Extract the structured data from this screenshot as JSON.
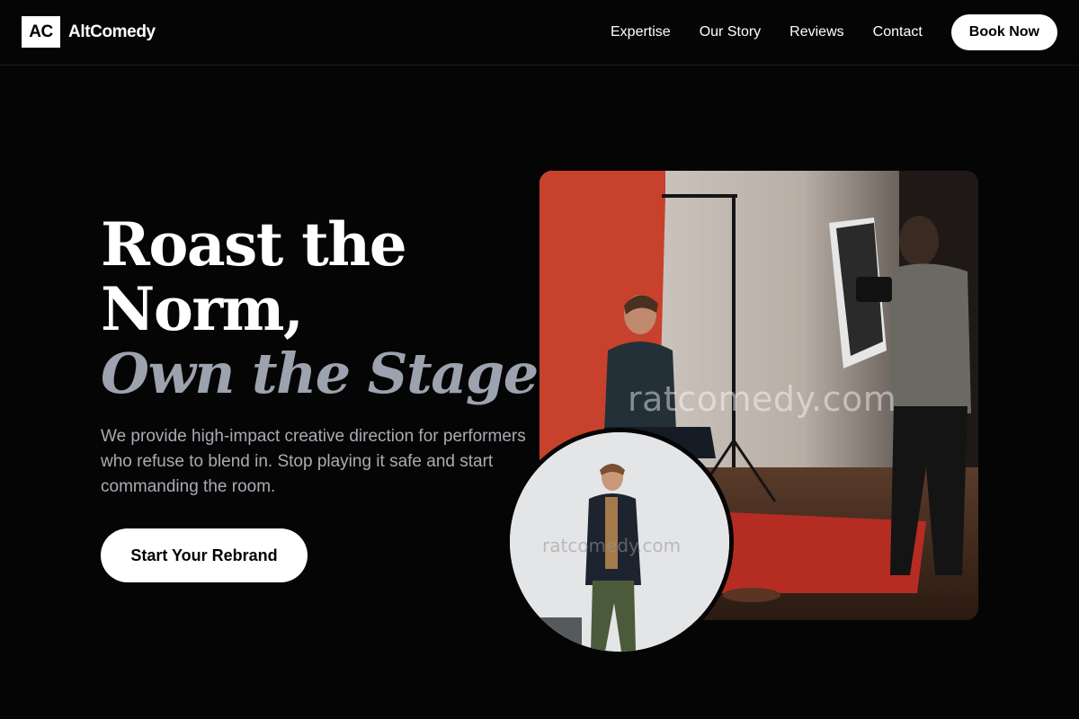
{
  "brand": {
    "mark": "AC",
    "name": "AltComedy"
  },
  "nav": {
    "links": [
      "Expertise",
      "Our Story",
      "Reviews",
      "Contact"
    ],
    "cta": "Book Now"
  },
  "hero": {
    "headline_line1": "Roast the",
    "headline_line2": "Norm,",
    "headline_accent": "Own the Stage.",
    "subtext": "We provide high-impact creative direction for performers who refuse to blend in. Stop playing it safe and start commanding the room.",
    "cta": "Start Your Rebrand"
  },
  "media": {
    "main_watermark": "ratcomedy.com",
    "inset_watermark": "ratcomedy.com"
  },
  "colors": {
    "background": "#050505",
    "text": "#ffffff",
    "accent_muted": "#9ca3af",
    "button_bg": "#ffffff"
  }
}
